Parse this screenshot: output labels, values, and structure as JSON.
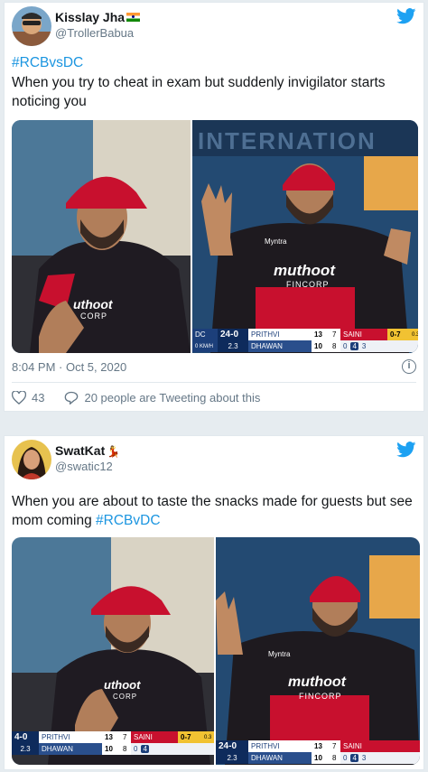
{
  "tweet1": {
    "name": "Kisslay Jha",
    "handle": "@TrollerBabua",
    "hashtag": "#RCBvsDC",
    "text": "When you try to cheat in exam but suddenly invigilator starts noticing you",
    "timestamp": "8:04 PM · Oct 5, 2020",
    "likes": "43",
    "tweeting": "20 people are Tweeting about this",
    "scoreboard": {
      "team": "DC",
      "score": "24-0",
      "batter1": "PRITHVI",
      "batter1_runs": "13",
      "batter1_balls": "7",
      "batter2": "DHAWAN",
      "batter2_runs": "10",
      "batter2_balls": "8",
      "bowler": "SAINI",
      "bowler_figures": "0-7",
      "overs": "2.3",
      "speed": "0 KM/H",
      "over_sub": "0.3",
      "ball_dot": "0",
      "ball_four": "4",
      "ball_three": "3"
    },
    "bg_text": "INTERNATION"
  },
  "tweet2": {
    "name": "SwatKat",
    "handle": "@swatic12",
    "text": "When you are about to taste the snacks made for guests but see mom coming",
    "hashtag": "#RCBvDC",
    "scoreboard_left": {
      "score": "4-0",
      "overs": "2.3",
      "batter1": "PRITHVI",
      "batter1_runs": "13",
      "batter1_balls": "7",
      "batter2": "DHAWAN",
      "batter2_runs": "10",
      "batter2_balls": "8",
      "bowler": "SAINI",
      "bowler_figures": "0-7",
      "over_sub": "0.3",
      "ball_dot": "0",
      "ball_four": "4"
    },
    "scoreboard_right": {
      "score": "24-0",
      "overs": "2.3",
      "batter1": "PRITHVI",
      "batter1_runs": "13",
      "batter1_balls": "7",
      "batter2": "DHAWAN",
      "batter2_runs": "10",
      "batter2_balls": "8",
      "bowler": "SAINI",
      "ball_dot": "0",
      "ball_four": "4",
      "ball_three": "3"
    }
  },
  "jersey": {
    "sponsor": "muthoot",
    "sponsor_sub": "FINCORP",
    "brand": "Myntra",
    "sponsor_partial": "uthoot",
    "sponsor_sub_partial": "CORP"
  },
  "colors": {
    "link": "#1b95e0",
    "muted": "#657786",
    "rcb_red": "#c8102e",
    "jersey_dark": "#1e1a1f"
  }
}
